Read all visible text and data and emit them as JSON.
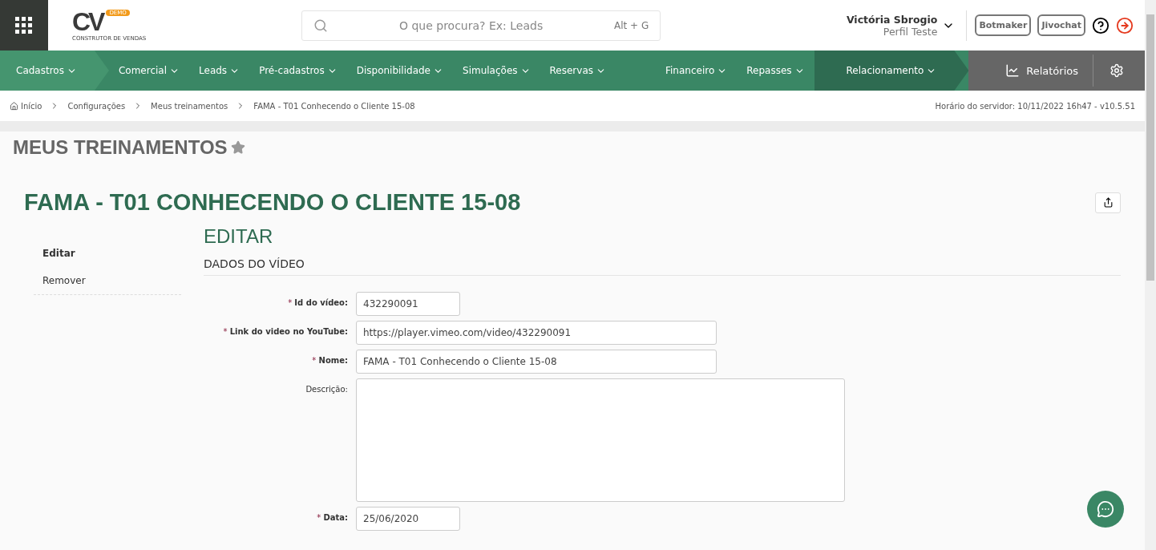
{
  "header": {
    "logo": {
      "letters": "CV",
      "badge": "DEMO",
      "tagline": "CONSTRUTOR DE VENDAS"
    },
    "search": {
      "placeholder": "O que procura? Ex: Leads",
      "shortcut": "Alt + G"
    },
    "user": {
      "name": "Victória Sbrogio",
      "profile": "Perfil Teste"
    },
    "buttons": [
      "Botmaker",
      "Jivochat"
    ]
  },
  "nav": {
    "items": [
      {
        "label": "Cadastros",
        "color": "#45956f"
      },
      {
        "label": "Comercial",
        "color": "#3a8765"
      },
      {
        "label": "Leads",
        "color": "#3a8765"
      },
      {
        "label": "Pré-cadastros",
        "color": "#3a8765"
      },
      {
        "label": "Disponibilidade",
        "color": "#3a8765"
      },
      {
        "label": "Simulações",
        "color": "#3a8765"
      },
      {
        "label": "Reservas",
        "color": "#3a8765"
      },
      {
        "label": "Financeiro",
        "color": "#3a8765"
      },
      {
        "label": "Repasses",
        "color": "#3a8765"
      },
      {
        "label": "Relacionamento",
        "color": "#2e6b51"
      }
    ],
    "reports": "Relatórios"
  },
  "breadcrumb": [
    "Início",
    "Configurações",
    "Meus treinamentos",
    "FAMA - T01 Conhecendo o Cliente 15-08"
  ],
  "server_time": "Horário do servidor: 10/11/2022 16h47 - v10.5.51",
  "page_title": "MEUS TREINAMENTOS",
  "favorite": false,
  "record_title": "FAMA - T01 CONHECENDO O CLIENTE 15-08",
  "side_menu": [
    {
      "label": "Editar",
      "selected": true
    },
    {
      "label": "Remover",
      "selected": false
    }
  ],
  "section_title": "EDITAR",
  "subsection": "DADOS DO VÍDEO",
  "fields": [
    {
      "label": "Id do vídeo:",
      "required": true,
      "kind": "short",
      "value": "432290091"
    },
    {
      "label": "Link do video no YouTube:",
      "required": true,
      "kind": "long",
      "value": "https://player.vimeo.com/video/432290091"
    },
    {
      "label": "Nome:",
      "required": true,
      "kind": "long",
      "value": "FAMA - T01 Conhecendo o Cliente 15-08"
    },
    {
      "label": "Descrição:",
      "required": false,
      "kind": "textarea"
    },
    {
      "label": "Data:",
      "required": true,
      "kind": "short",
      "value": "25/06/2020"
    }
  ],
  "required_mark": "*"
}
